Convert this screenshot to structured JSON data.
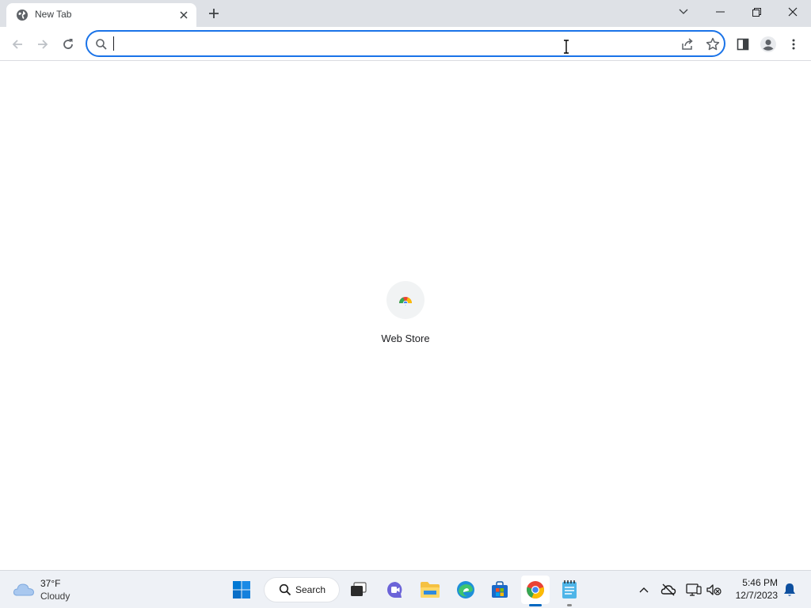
{
  "browser": {
    "tab": {
      "title": "New Tab",
      "favicon": "globe-icon"
    },
    "window_controls": [
      "tab-search-chevron-icon",
      "minimize-icon",
      "restore-icon",
      "close-icon"
    ],
    "toolbar": {
      "back": "back-arrow-icon",
      "forward": "forward-arrow-icon",
      "reload": "reload-icon",
      "omnibox": {
        "value": "",
        "placeholder": ""
      },
      "right_icons": [
        "share-icon",
        "star-icon",
        "side-panel-icon",
        "profile-icon",
        "menu-dots-icon"
      ]
    },
    "accent_color": "#1a73e8"
  },
  "content": {
    "shortcuts": [
      {
        "label": "Web Store",
        "icon": "chrome-web-store-icon"
      }
    ]
  },
  "taskbar": {
    "weather": {
      "temp": "37°F",
      "condition": "Cloudy",
      "icon": "cloud-icon"
    },
    "search_label": "Search",
    "pinned": [
      "start-windows-icon",
      "search-icon",
      "task-view-icon",
      "teams-chat-icon",
      "file-explorer-icon",
      "edge-icon",
      "microsoft-store-icon",
      "chrome-icon",
      "notepad-icon"
    ],
    "tray": [
      "chevron-up-icon",
      "onedrive-offline-icon",
      "display-icon",
      "volume-muted-icon",
      "notification-bell-icon"
    ],
    "clock": {
      "time": "5:46 PM",
      "date": "12/7/2023"
    }
  }
}
